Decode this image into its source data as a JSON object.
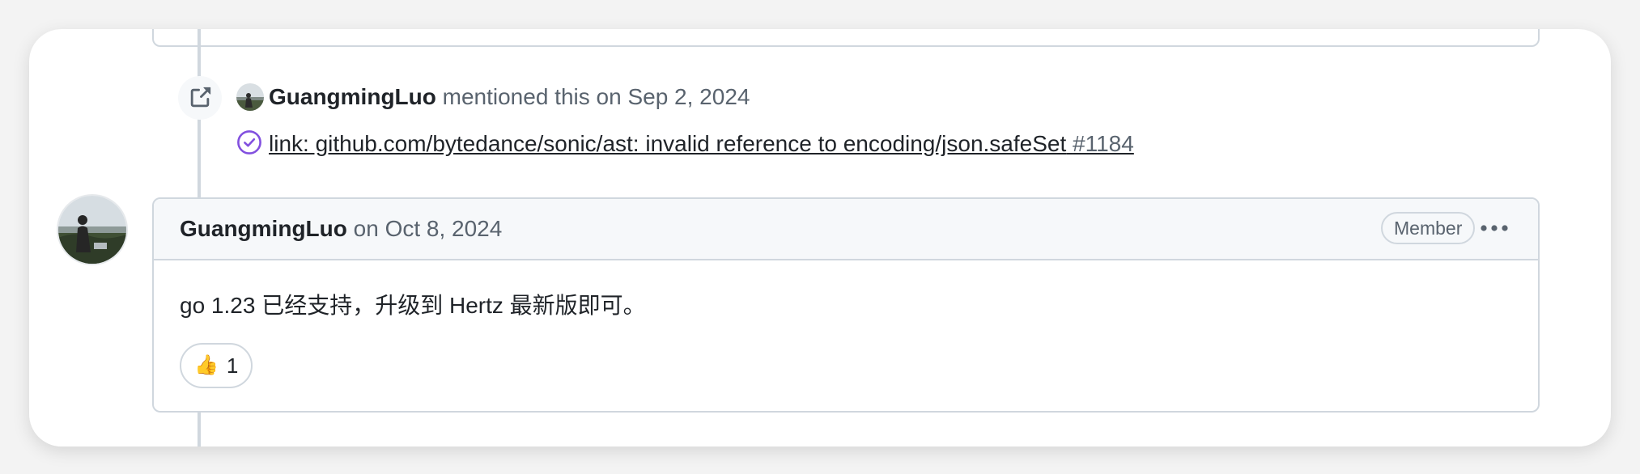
{
  "mention_event": {
    "author": "GuangmingLuo",
    "action": "mentioned this",
    "date": "on Sep 2, 2024",
    "reference_title": "link: github.com/bytedance/sonic/ast: invalid reference to encoding/json.safeSet",
    "reference_number": "#1184",
    "event_icon": "cross-reference-icon",
    "status_icon": "check-circle-icon",
    "status_color": "#8250df"
  },
  "comment": {
    "author": "GuangmingLuo",
    "date": "on Oct 8, 2024",
    "role_badge": "Member",
    "body": "go 1.23 已经支持，升级到 Hertz 最新版即可。",
    "reactions": [
      {
        "emoji": "👍",
        "count": "1"
      }
    ]
  },
  "colors": {
    "border": "#d0d7de",
    "header_bg": "#f6f8fa",
    "muted_text": "#59636e",
    "text": "#1f2328"
  }
}
